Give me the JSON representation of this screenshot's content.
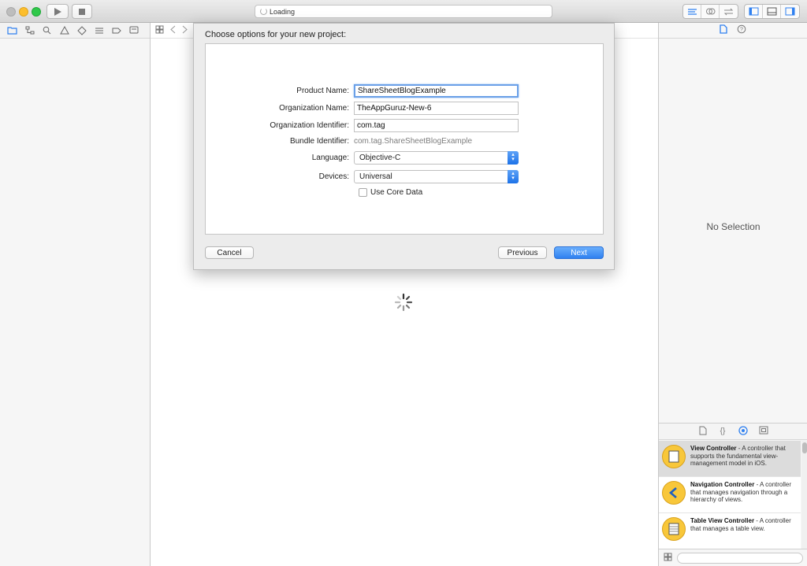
{
  "toolbar": {
    "activity_text": "Loading"
  },
  "sheet": {
    "title": "Choose options for your new project:",
    "fields": {
      "product_name_label": "Product Name:",
      "product_name_value": "ShareSheetBlogExample",
      "org_name_label": "Organization Name:",
      "org_name_value": "TheAppGuruz-New-6",
      "org_id_label": "Organization Identifier:",
      "org_id_value": "com.tag",
      "bundle_id_label": "Bundle Identifier:",
      "bundle_id_value": "com.tag.ShareSheetBlogExample",
      "language_label": "Language:",
      "language_value": "Objective-C",
      "devices_label": "Devices:",
      "devices_value": "Universal",
      "core_data_label": "Use Core Data"
    },
    "buttons": {
      "cancel": "Cancel",
      "previous": "Previous",
      "next": "Next"
    }
  },
  "inspector": {
    "no_selection": "No Selection"
  },
  "library": {
    "items": [
      {
        "title": "View Controller",
        "desc": " - A controller that supports the fundamental view-management model in iOS."
      },
      {
        "title": "Navigation Controller",
        "desc": " - A controller that manages navigation through a hierarchy of views."
      },
      {
        "title": "Table View Controller",
        "desc": " - A controller that manages a table view."
      }
    ]
  },
  "colors": {
    "accent": "#2f80f0",
    "library_icon": "#f8c73a"
  }
}
